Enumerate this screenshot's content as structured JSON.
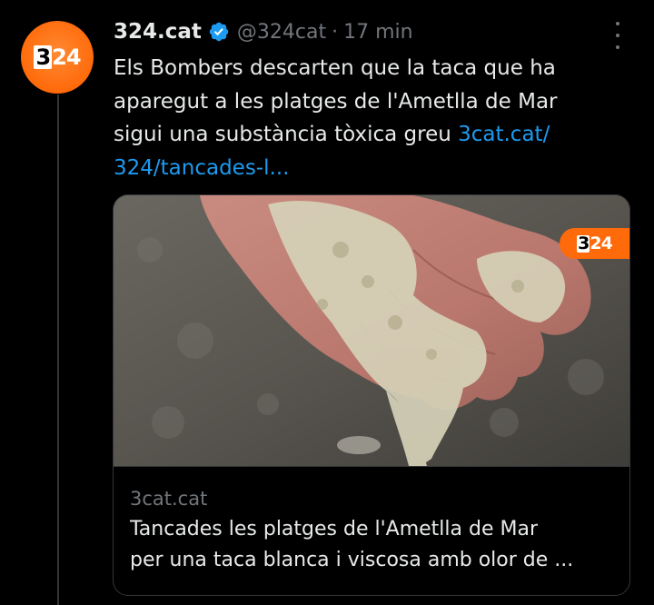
{
  "tweet": {
    "display_name": "324.cat",
    "handle": "@324cat",
    "separator": "·",
    "time": "17 min",
    "text": "Els Bombers descarten que la taca que ha aparegut a les platges de l'Ametlla de Mar sigui una substància tòxica greu",
    "text_lines": [
      "Els Bombers descarten que la taca que ha",
      "aparegut a les platges de l'Ametlla de Mar",
      "sigui una substància tòxica greu "
    ],
    "link_part1": "3cat.cat/",
    "link_part2": "324/tancades-l...",
    "verified_color": "#1d9bf0",
    "link_color": "#1d9bf0"
  },
  "avatar": {
    "logo_boxed": "3",
    "logo_rest": "24",
    "color": "#ff6a0a"
  },
  "card": {
    "domain": "3cat.cat",
    "title_lines": [
      "Tancades les platges de l'Ametlla de Mar",
      "per una taca blanca i viscosa amb olor de ..."
    ],
    "image_logo_boxed": "3",
    "image_logo_rest": "24"
  },
  "icons": {
    "verified": "verified-badge-icon",
    "more": "more-options-icon"
  }
}
